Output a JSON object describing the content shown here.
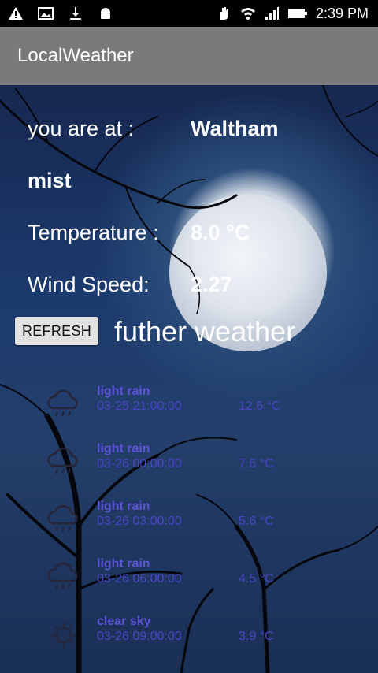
{
  "status_bar": {
    "time": "2:39 PM",
    "left_icons": [
      "warning-icon",
      "image-icon",
      "download-icon",
      "android-icon"
    ],
    "right_icons": [
      "hand-icon",
      "wifi-icon",
      "signal-icon",
      "battery-icon"
    ]
  },
  "app": {
    "title": "LocalWeather"
  },
  "current": {
    "location_label": "you are at :",
    "location_value": "Waltham",
    "condition": "mist",
    "temperature_label": "Temperature :",
    "temperature_value": "8.0 °C",
    "wind_label": "Wind Speed:",
    "wind_value": "2.27"
  },
  "controls": {
    "refresh_label": "REFRESH",
    "further_label": "futher weather"
  },
  "forecast": [
    {
      "icon": "cloud-rain-icon",
      "desc": "light rain",
      "time": "03-25 21:00:00",
      "temp": "12.6 °C"
    },
    {
      "icon": "cloud-rain-icon",
      "desc": "light rain",
      "time": "03-26 00:00:00",
      "temp": "7.6 °C"
    },
    {
      "icon": "cloud-rain-icon",
      "desc": "light rain",
      "time": "03-26 03:00:00",
      "temp": "5.6 °C"
    },
    {
      "icon": "cloud-rain-icon",
      "desc": "light rain",
      "time": "03-26 06:00:00",
      "temp": "4.5 °C"
    },
    {
      "icon": "sun-icon",
      "desc": "clear sky",
      "time": "03-26 09:00:00",
      "temp": "3.9 °C"
    }
  ],
  "colors": {
    "app_bar": "#7a7a7a",
    "forecast_text": "#4a44c4",
    "status_bar": "#000000"
  }
}
